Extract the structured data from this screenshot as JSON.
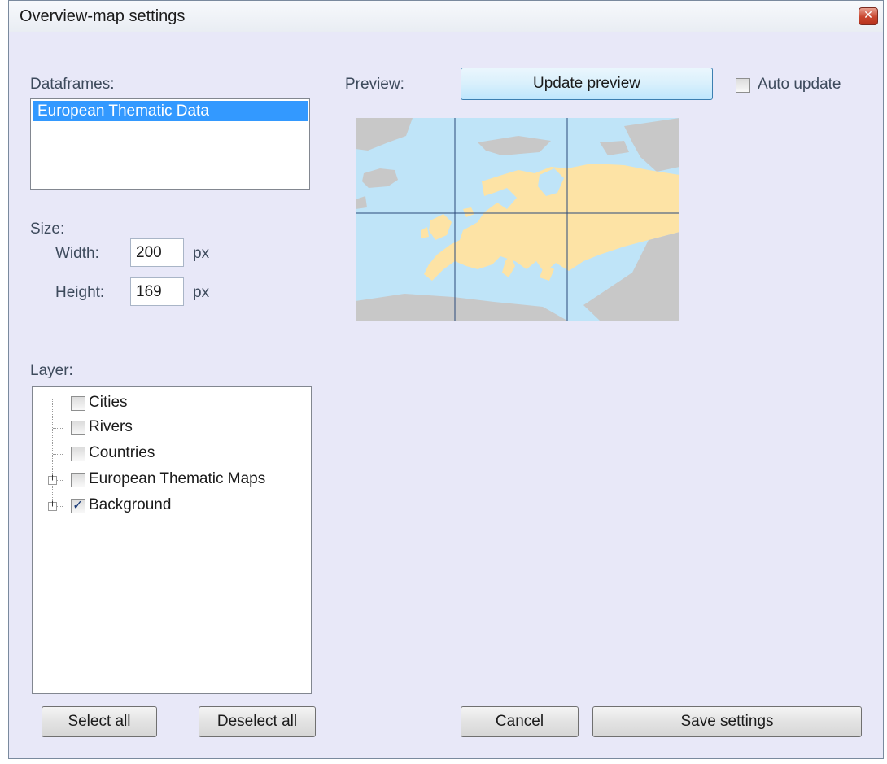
{
  "window": {
    "title": "Overview-map settings",
    "close_icon": "close-icon"
  },
  "dataframes": {
    "label": "Dataframes:",
    "items": [
      "European Thematic Data"
    ],
    "selected": "European Thematic Data"
  },
  "size": {
    "label": "Size:",
    "width_label": "Width:",
    "width_value": "200",
    "width_unit": "px",
    "height_label": "Height:",
    "height_value": "169",
    "height_unit": "px"
  },
  "layer": {
    "label": "Layer:",
    "items": [
      {
        "label": "Cities",
        "checked": false,
        "expandable": false
      },
      {
        "label": "Rivers",
        "checked": false,
        "expandable": false
      },
      {
        "label": "Countries",
        "checked": false,
        "expandable": false
      },
      {
        "label": "European Thematic Maps",
        "checked": false,
        "expandable": true
      },
      {
        "label": "Background",
        "checked": true,
        "expandable": true
      }
    ]
  },
  "preview": {
    "label": "Preview:",
    "update_button": "Update preview",
    "auto_update_label": "Auto update",
    "auto_update_checked": false
  },
  "buttons": {
    "select_all": "Select all",
    "deselect_all": "Deselect all",
    "cancel": "Cancel",
    "save": "Save settings"
  },
  "colors": {
    "land": "#fde3a5",
    "water": "#bfe4f8",
    "other_land": "#c8c8c8",
    "selection": "#3399ff",
    "dialog_bg": "#e8e8f8"
  }
}
